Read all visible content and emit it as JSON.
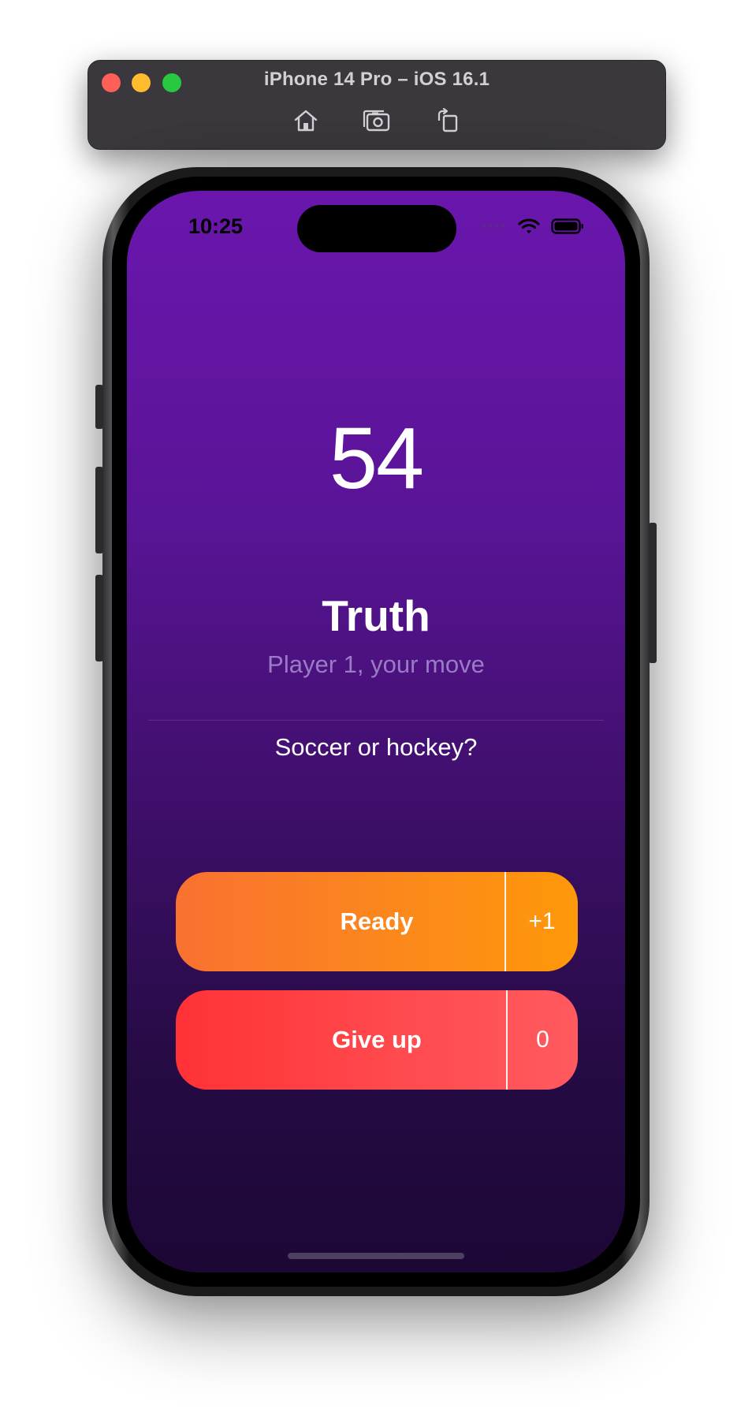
{
  "simulator": {
    "title": "iPhone 14 Pro – iOS 16.1",
    "tools": [
      {
        "icon": "home-icon"
      },
      {
        "icon": "screenshot-icon"
      },
      {
        "icon": "rotate-icon"
      }
    ]
  },
  "status_bar": {
    "time": "10:25",
    "icons": [
      "cellular-icon",
      "wifi-icon",
      "battery-icon"
    ]
  },
  "game": {
    "timer": "54",
    "mode": "Truth",
    "player_line": "Player 1, your move",
    "question": "Soccer or hockey?"
  },
  "actions": {
    "ready": {
      "label": "Ready",
      "score": "+1",
      "color_start": "#f97131",
      "color_end": "#ff980a"
    },
    "give_up": {
      "label": "Give up",
      "score": "0",
      "color_start": "#ff3236",
      "color_end": "#ff5a5e"
    }
  },
  "colors": {
    "background_top": "#6a16ad",
    "background_bottom": "#1c0735",
    "subtitle": "#9a7bc6"
  }
}
